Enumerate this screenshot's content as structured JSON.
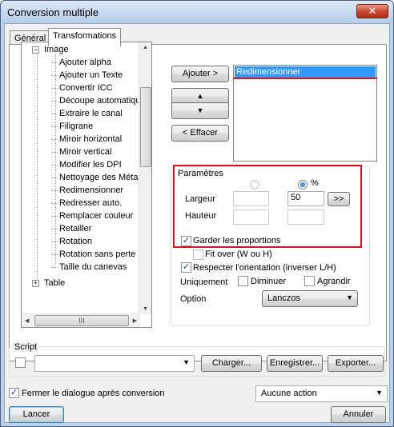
{
  "window": {
    "title": "Conversion multiple",
    "close_symbol": "✕"
  },
  "tabs": [
    {
      "label": "Général",
      "active": false
    },
    {
      "label": "Transformations",
      "active": true
    }
  ],
  "tree": {
    "image_node": "Image",
    "items": [
      "Ajouter alpha",
      "Ajouter un Texte",
      "Convertir ICC",
      "Découpe automatique",
      "Extraire le canal",
      "Filigrane",
      "Miroir horizontal",
      "Miroir vertical",
      "Modifier les DPI",
      "Nettoyage des Métadon",
      "Redimensionner",
      "Redresser auto.",
      "Remplacer couleur",
      "Retailler",
      "Rotation",
      "Rotation sans perte",
      "Taille du canevas"
    ],
    "table_node": "Table",
    "collapse_symbol": "−",
    "expand_symbol": "+",
    "hscroll_grip": "III"
  },
  "buttons": {
    "add": "Ajouter >",
    "up": "▲",
    "down": "▼",
    "clear": "< Effacer",
    "more": ">>",
    "load": "Charger...",
    "save": "Enregistrer...",
    "export": "Exporter...",
    "launch": "Lancer",
    "cancel": "Annuler"
  },
  "list": {
    "items": [
      "Redimensionner"
    ]
  },
  "params": {
    "group_label": "Paramètres",
    "unit_percent": "%",
    "width_label": "Largeur",
    "height_label": "Hauteur",
    "width_percent_value": "50",
    "keep_proportions": "Garder les proportions",
    "fit_over": "Fit over (W ou H)",
    "respect_orientation": "Respecter l'orientation (inverser L/H)",
    "only_label": "Uniquement",
    "decrease": "Diminuer",
    "increase": "Agrandir",
    "option_label": "Option",
    "option_value": "Lanczos"
  },
  "script": {
    "group_label": "Script",
    "combo_value": ""
  },
  "footer": {
    "close_after": "Fermer le dialogue après conversion",
    "action_value": "Aucune action"
  },
  "colors": {
    "highlight": "#d8141c",
    "selection": "#3399ff"
  }
}
